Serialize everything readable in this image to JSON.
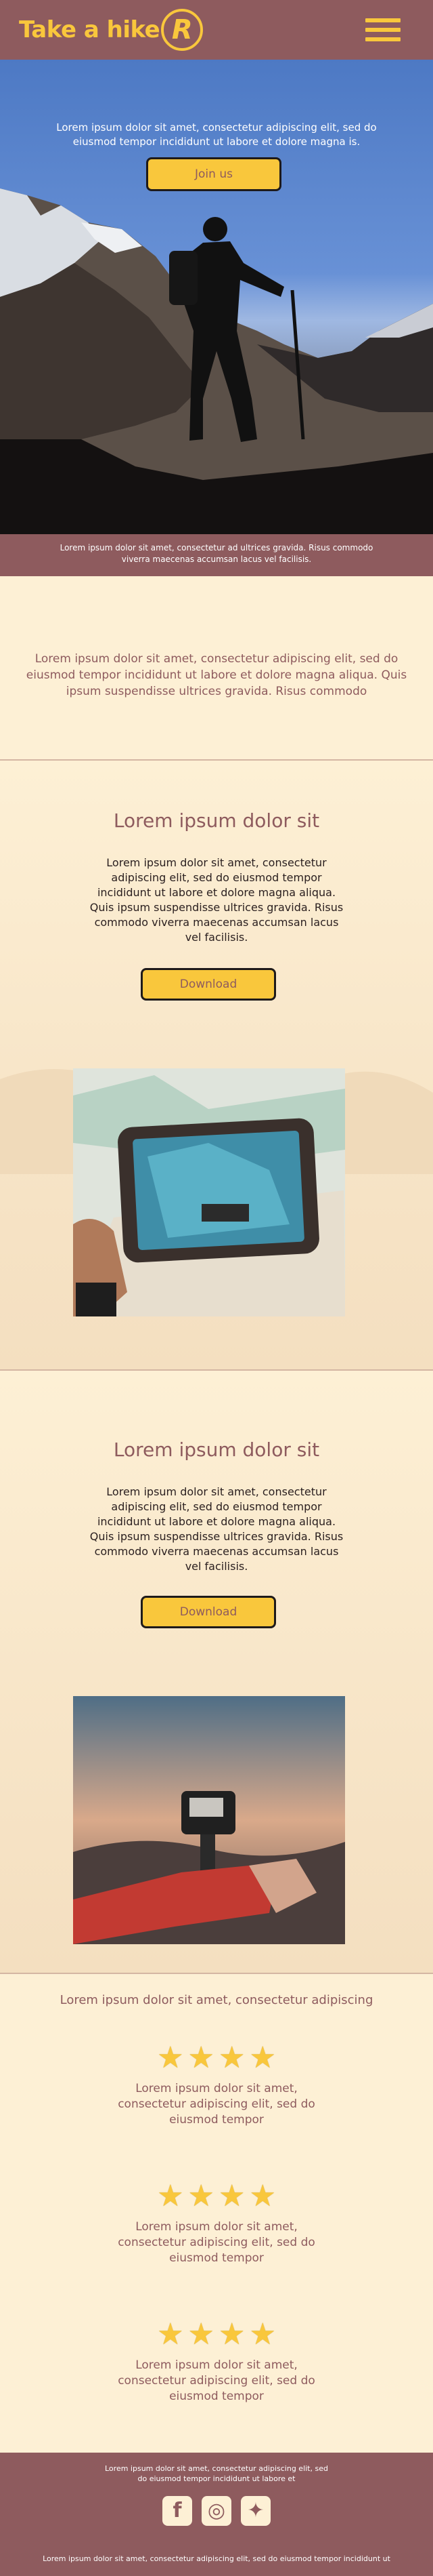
{
  "header": {
    "logo_text": "Take a hike",
    "logo_badge": "R",
    "menu_icon": "hamburger-icon"
  },
  "hero": {
    "text": "Lorem ipsum dolor sit amet, consectetur adipiscing elit, sed do eiusmod tempor incididunt ut labore et dolore magna is.",
    "button_label": "Join us"
  },
  "caption": "Lorem ipsum dolor sit amet, consectetur ad ultrices gravida. Risus commodo viverra maecenas accumsan lacus vel facilisis.",
  "intro": "Lorem ipsum dolor sit amet, consectetur adipiscing elit, sed do eiusmod tempor incididunt ut labore et dolore magna aliqua. Quis ipsum suspendisse ultrices gravida. Risus commodo",
  "sections": [
    {
      "title": "Lorem ipsum dolor sit",
      "body": "Lorem ipsum dolor sit amet, consectetur adipiscing elit, sed do eiusmod tempor incididunt ut labore et dolore magna aliqua. Quis ipsum suspendisse ultrices gravida. Risus commodo viverra maecenas accumsan lacus vel facilisis.",
      "button_label": "Download"
    },
    {
      "title": "Lorem ipsum dolor sit",
      "body": "Lorem ipsum dolor sit amet, consectetur adipiscing elit, sed do eiusmod tempor incididunt ut labore et dolore magna aliqua. Quis ipsum suspendisse ultrices gravida. Risus commodo viverra maecenas accumsan lacus vel facilisis.",
      "button_label": "Download"
    }
  ],
  "reviews": {
    "title": "Lorem ipsum dolor sit amet, consectetur adipiscing",
    "rating": 4,
    "items": [
      {
        "text": "Lorem ipsum dolor sit amet, consectetur adipiscing elit, sed do eiusmod tempor"
      },
      {
        "text": "Lorem ipsum dolor sit amet, consectetur adipiscing elit, sed do eiusmod tempor"
      },
      {
        "text": "Lorem ipsum dolor sit amet, consectetur adipiscing elit, sed do eiusmod tempor"
      }
    ]
  },
  "footer": {
    "text": "Lorem ipsum dolor sit amet, consectetur adipiscing elit, sed do eiusmod tempor incididunt ut labore et",
    "social": [
      {
        "icon": "facebook-icon",
        "glyph": "f"
      },
      {
        "icon": "instagram-icon",
        "glyph": "◎"
      },
      {
        "icon": "twitter-icon",
        "glyph": "✦"
      }
    ],
    "bottom_text": "Lorem ipsum dolor sit amet, consectetur adipiscing elit, sed do eiusmod tempor incididunt ut"
  },
  "colors": {
    "brand": "#8e5b5e",
    "accent": "#f9c73c",
    "background": "#fdf0d5"
  }
}
